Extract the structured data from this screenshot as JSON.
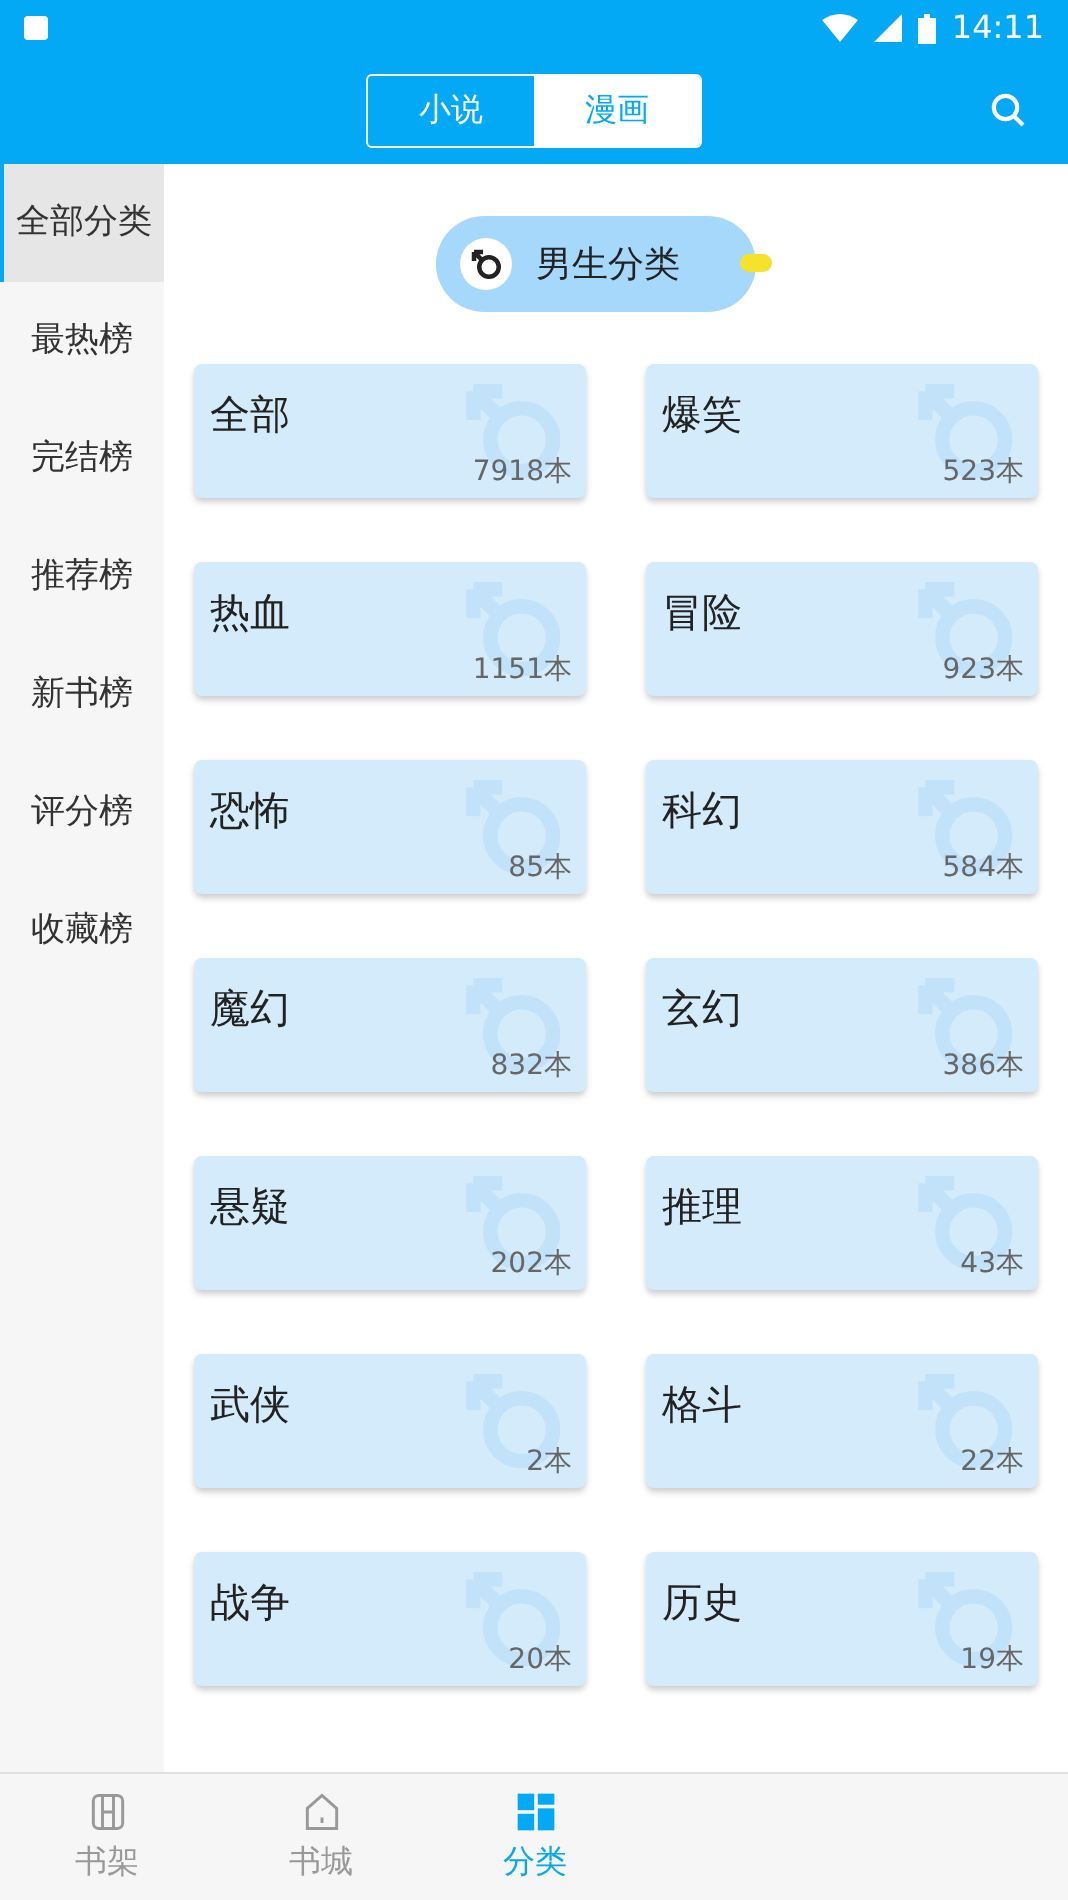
{
  "status_bar": {
    "time": "14:11"
  },
  "header": {
    "tabs": [
      {
        "label": "小说",
        "selected": false
      },
      {
        "label": "漫画",
        "selected": true
      }
    ]
  },
  "sidebar": {
    "items": [
      {
        "label": "全部分类",
        "selected": true
      },
      {
        "label": "最热榜",
        "selected": false
      },
      {
        "label": "完结榜",
        "selected": false
      },
      {
        "label": "推荐榜",
        "selected": false
      },
      {
        "label": "新书榜",
        "selected": false
      },
      {
        "label": "评分榜",
        "selected": false
      },
      {
        "label": "收藏榜",
        "selected": false
      }
    ]
  },
  "section": {
    "title": "男生分类"
  },
  "categories": [
    {
      "name": "全部",
      "count": "7918本"
    },
    {
      "name": "爆笑",
      "count": "523本"
    },
    {
      "name": "热血",
      "count": "1151本"
    },
    {
      "name": "冒险",
      "count": "923本"
    },
    {
      "name": "恐怖",
      "count": "85本"
    },
    {
      "name": "科幻",
      "count": "584本"
    },
    {
      "name": "魔幻",
      "count": "832本"
    },
    {
      "name": "玄幻",
      "count": "386本"
    },
    {
      "name": "悬疑",
      "count": "202本"
    },
    {
      "name": "推理",
      "count": "43本"
    },
    {
      "name": "武侠",
      "count": "2本"
    },
    {
      "name": "格斗",
      "count": "22本"
    },
    {
      "name": "战争",
      "count": "20本"
    },
    {
      "name": "历史",
      "count": "19本"
    }
  ],
  "bottom_nav": [
    {
      "label": "书架",
      "kind": "shelf",
      "selected": false
    },
    {
      "label": "书城",
      "kind": "home",
      "selected": false
    },
    {
      "label": "分类",
      "kind": "grid",
      "selected": true
    }
  ]
}
